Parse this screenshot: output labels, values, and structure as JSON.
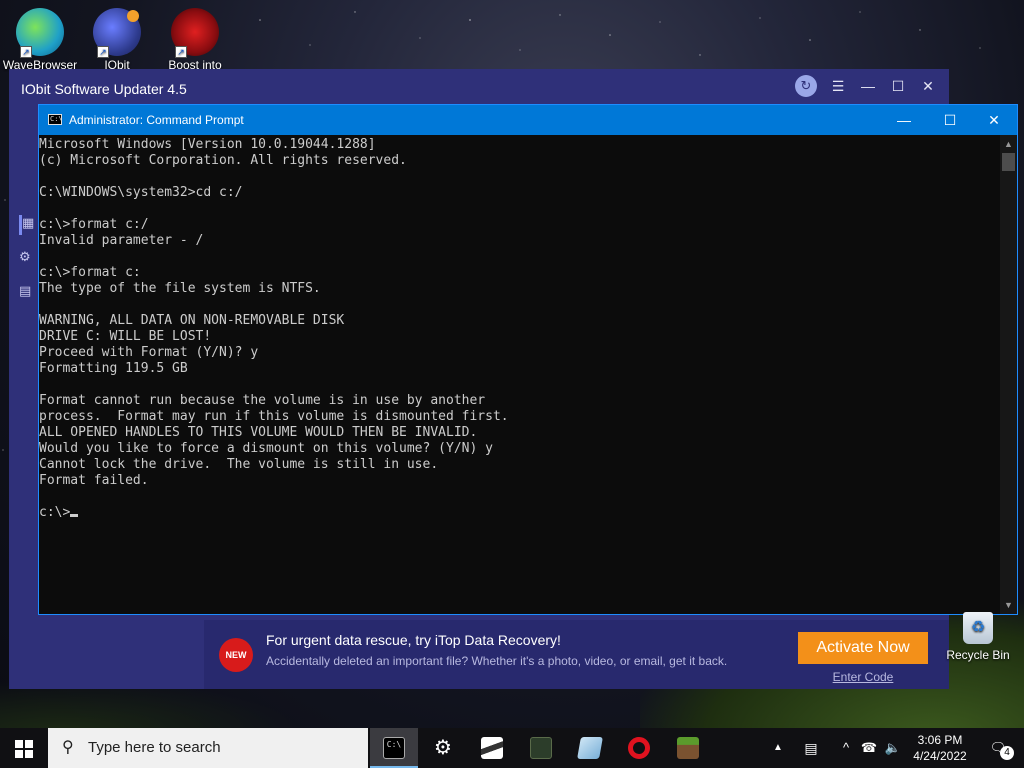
{
  "desktop": {
    "icons": [
      {
        "label": "WaveBrowser",
        "icon": "wavebrowser-icon",
        "color": "#1fa0c8"
      },
      {
        "label": "IObit",
        "icon": "iobit-icon",
        "color": "#2d3a8c"
      },
      {
        "label": "Boost into",
        "icon": "boost-icon",
        "color": "#c0141b"
      }
    ],
    "recycle_bin": {
      "label": "Recycle Bin",
      "icon": "recycle-bin-icon"
    }
  },
  "iobit": {
    "title": "IObit Software Updater 4.5",
    "promo": {
      "badge": "NEW",
      "headline": "For urgent data rescue, try iTop Data Recovery!",
      "sub": "Accidentally deleted an important file? Whether it's a photo, video, or email, get it back.",
      "activate": "Activate Now",
      "enter_code": "Enter Code"
    }
  },
  "cmd": {
    "title": "Administrator: Command Prompt",
    "icon_text": "C:\\",
    "lines": [
      "Microsoft Windows [Version 10.0.19044.1288]",
      "(c) Microsoft Corporation. All rights reserved.",
      "",
      "C:\\WINDOWS\\system32>cd c:/",
      "",
      "c:\\>format c:/",
      "Invalid parameter - /",
      "",
      "c:\\>format c:",
      "The type of the file system is NTFS.",
      "",
      "WARNING, ALL DATA ON NON-REMOVABLE DISK",
      "DRIVE C: WILL BE LOST!",
      "Proceed with Format (Y/N)? y",
      "Formatting 119.5 GB",
      "",
      "Format cannot run because the volume is in use by another",
      "process.  Format may run if this volume is dismounted first.",
      "ALL OPENED HANDLES TO THIS VOLUME WOULD THEN BE INVALID.",
      "Would you like to force a dismount on this volume? (Y/N) y",
      "Cannot lock the drive.  The volume is still in use.",
      "Format failed.",
      ""
    ],
    "prompt": "c:\\>"
  },
  "taskbar": {
    "search_placeholder": "Type here to search",
    "apps": [
      {
        "name": "command-prompt",
        "icon": "cmd-icon",
        "active": true
      },
      {
        "name": "settings",
        "icon": "gear-icon"
      },
      {
        "name": "photos",
        "icon": "photos-icon"
      },
      {
        "name": "minecraft-dungeons",
        "icon": "game-icon-1"
      },
      {
        "name": "notepad",
        "icon": "notepad-icon"
      },
      {
        "name": "opera",
        "icon": "opera-icon"
      },
      {
        "name": "minecraft",
        "icon": "game-icon-2"
      }
    ],
    "time": "3:06 PM",
    "date": "4/24/2022",
    "notification_count": "4"
  }
}
